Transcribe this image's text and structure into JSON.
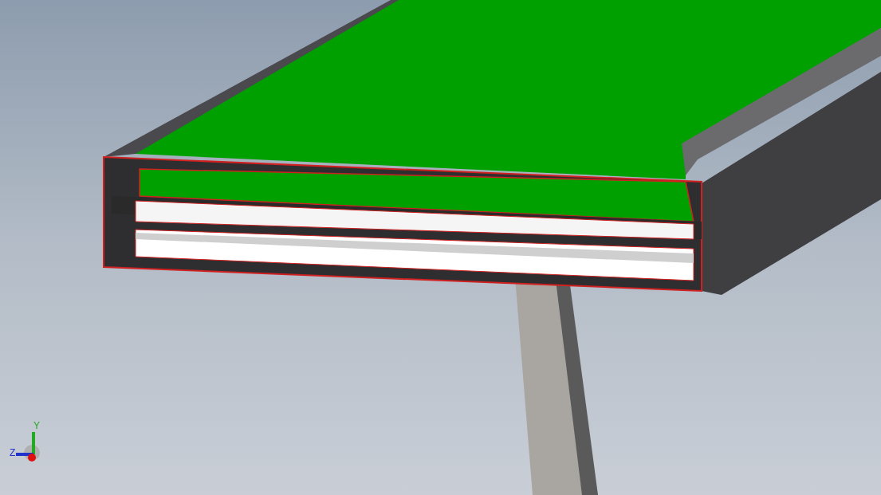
{
  "viewport": {
    "triad": {
      "axes": [
        {
          "label": "Y",
          "color": "#22aa22",
          "kind": "vertical"
        },
        {
          "label": "Z",
          "color": "#2233cc",
          "kind": "horizontal"
        }
      ]
    }
  }
}
